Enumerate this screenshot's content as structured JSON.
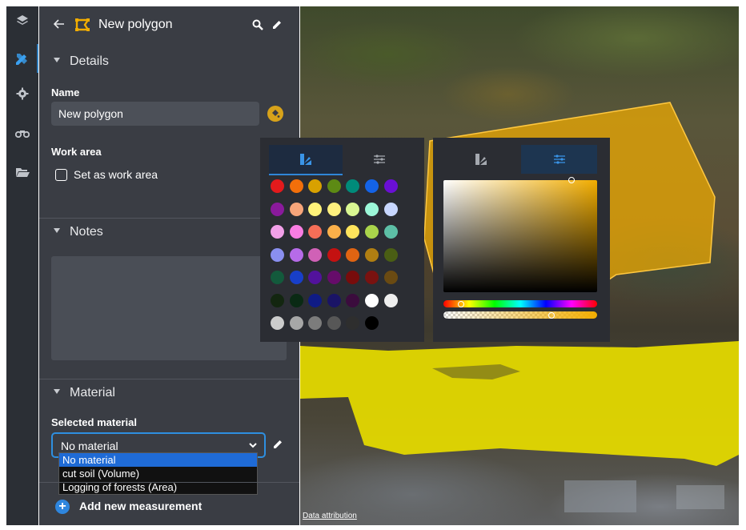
{
  "panel": {
    "title": "New polygon",
    "details": {
      "header": "Details",
      "name_label": "Name",
      "name_value": "New polygon",
      "work_area_label": "Work area",
      "set_work_area_label": "Set as work area",
      "set_work_area_checked": false
    },
    "notes": {
      "header": "Notes",
      "value": ""
    },
    "material": {
      "header": "Material",
      "selected_label": "Selected material",
      "selected_value": "No material",
      "options": [
        "No material",
        "cut soil (Volume)",
        "Logging of forests (Area)"
      ]
    },
    "add_measurement_label": "Add new measurement"
  },
  "map": {
    "attribution": "Data attribution",
    "polygon_color": "#f2ad00"
  },
  "palette": {
    "swatches": [
      [
        "#e31a1c",
        "#f36f0a",
        "#d8a100",
        "#5d8a14",
        "#008b7a",
        "#1463e8",
        "#6a0fd4"
      ],
      [
        "#8a1a9c",
        "#f7a57a",
        "#fff27a",
        "#fff07e",
        "#d9f792",
        "#9cf7d9",
        "#c8d7ff"
      ],
      [
        "#f2a0e8",
        "#f97de2",
        "#f56e57",
        "#fbb04a",
        "#ffe45c",
        "#a9d44b",
        "#5dbfa6"
      ],
      [
        "#8a8ff0",
        "#b66be8",
        "#d061b6",
        "#c41111",
        "#e06412",
        "#b07f12",
        "#4a5e14"
      ],
      [
        "#135a3c",
        "#183fc9",
        "#52129c",
        "#660c6a",
        "#780c0c",
        "#7a1210",
        "#6a4a12"
      ],
      [
        "#132610",
        "#0a2a14",
        "#0f1b85",
        "#1a1466",
        "#3b0c3d",
        "#ffffff",
        "#eeeeee"
      ],
      [
        "#cccccc",
        "#a7a7a7",
        "#7c7c7c",
        "#575757",
        "#2e2e2e",
        "#000000"
      ]
    ],
    "current_color": "#f2ad00"
  }
}
